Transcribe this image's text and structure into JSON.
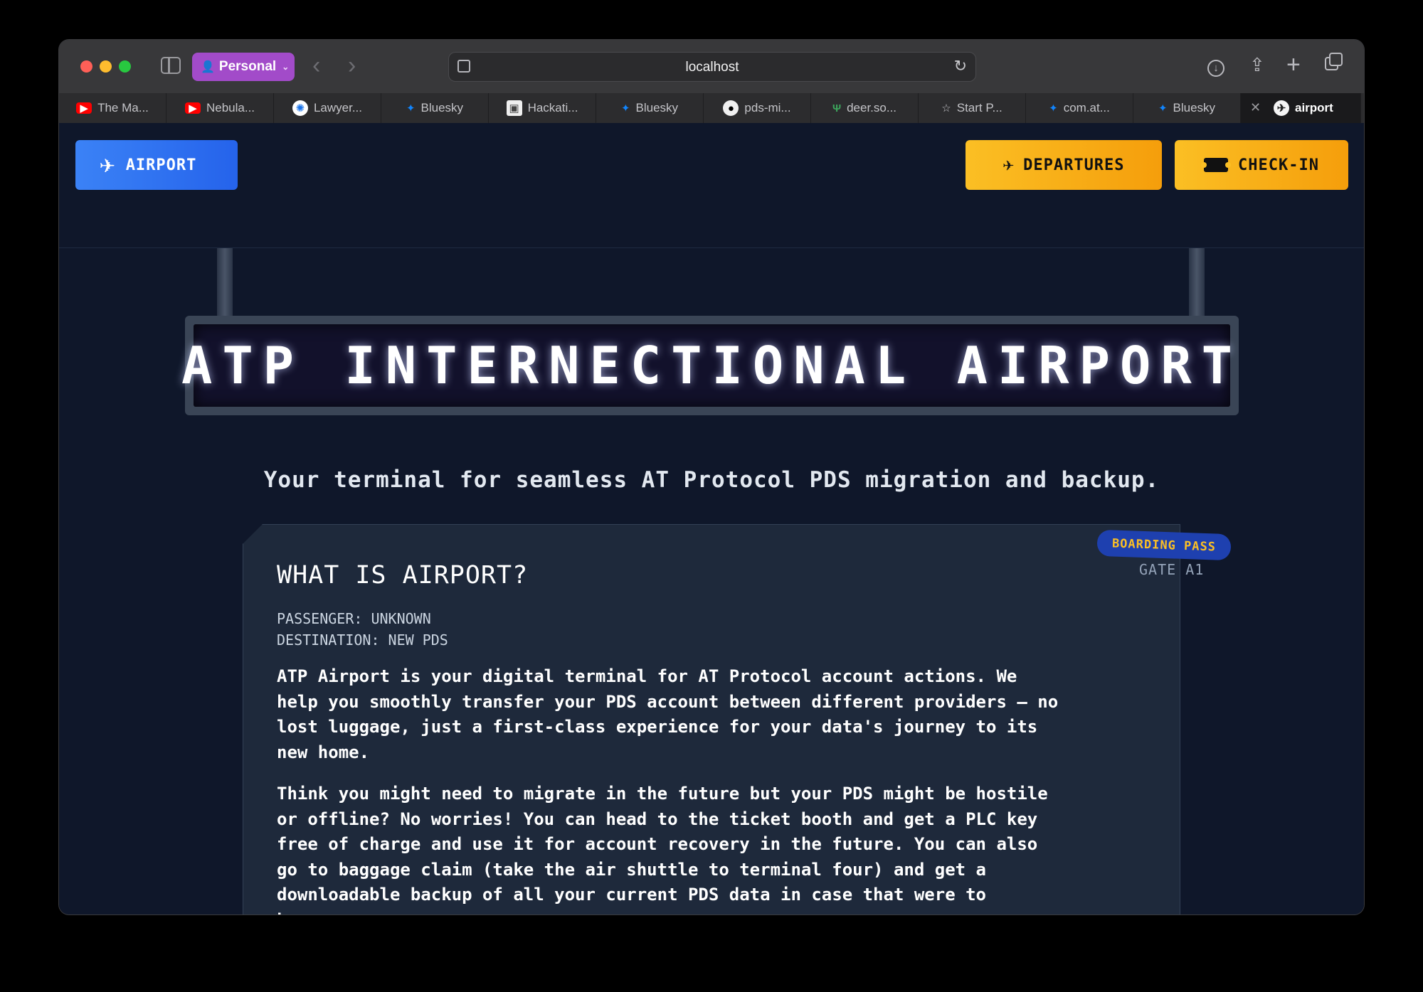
{
  "browser": {
    "profile_label": "Personal",
    "url": "localhost",
    "tabs": [
      {
        "title": "The Ma...",
        "icon": "youtube-icon"
      },
      {
        "title": "Nebula...",
        "icon": "youtube-icon"
      },
      {
        "title": "Lawyer...",
        "icon": "star-badge-icon"
      },
      {
        "title": "Bluesky",
        "icon": "butterfly-icon"
      },
      {
        "title": "Hackati...",
        "icon": "image-icon"
      },
      {
        "title": "Bluesky",
        "icon": "butterfly-icon"
      },
      {
        "title": "pds-mi...",
        "icon": "github-icon"
      },
      {
        "title": "deer.so...",
        "icon": "deer-icon"
      },
      {
        "title": "Start P...",
        "icon": "star-icon"
      },
      {
        "title": "com.at...",
        "icon": "butterfly-icon"
      },
      {
        "title": "Bluesky",
        "icon": "butterfly-icon"
      },
      {
        "title": "airport",
        "icon": "airport-icon",
        "active": true
      }
    ]
  },
  "header": {
    "brand_label": "AIRPORT",
    "departures_label": "DEPARTURES",
    "checkin_label": "CHECK-IN"
  },
  "hero": {
    "sign_text": "ATP INTERNECTIONAL AIRPORT",
    "tagline": "Your terminal for seamless AT Protocol PDS migration and backup."
  },
  "boarding_pass": {
    "badge": "BOARDING PASS",
    "gate": "GATE A1",
    "title": "WHAT IS AIRPORT?",
    "passenger": "PASSENGER: UNKNOWN",
    "destination": "DESTINATION: NEW PDS",
    "paragraph_1": "ATP Airport is your digital terminal for AT Protocol account actions. We\nhelp you smoothly transfer your PDS account between different providers – no\nlost luggage, just a first-class experience for your data's journey to its\nnew home.",
    "paragraph_2": "Think you might need to migrate in the future but your PDS might be hostile\nor offline? No worries! You can head to the ticket booth and get a PLC key\nfree of charge and use it for account recovery in the future. You can also\ngo to baggage claim (take the air shuttle to terminal four) and get a\ndownloadable backup of all your current PDS data in case that were to\nhappen."
  },
  "colors": {
    "brand_blue": "#3b82f6",
    "action_amber": "#fbbf24",
    "page_bg": "#0f172a",
    "card_bg": "#1e293b"
  }
}
